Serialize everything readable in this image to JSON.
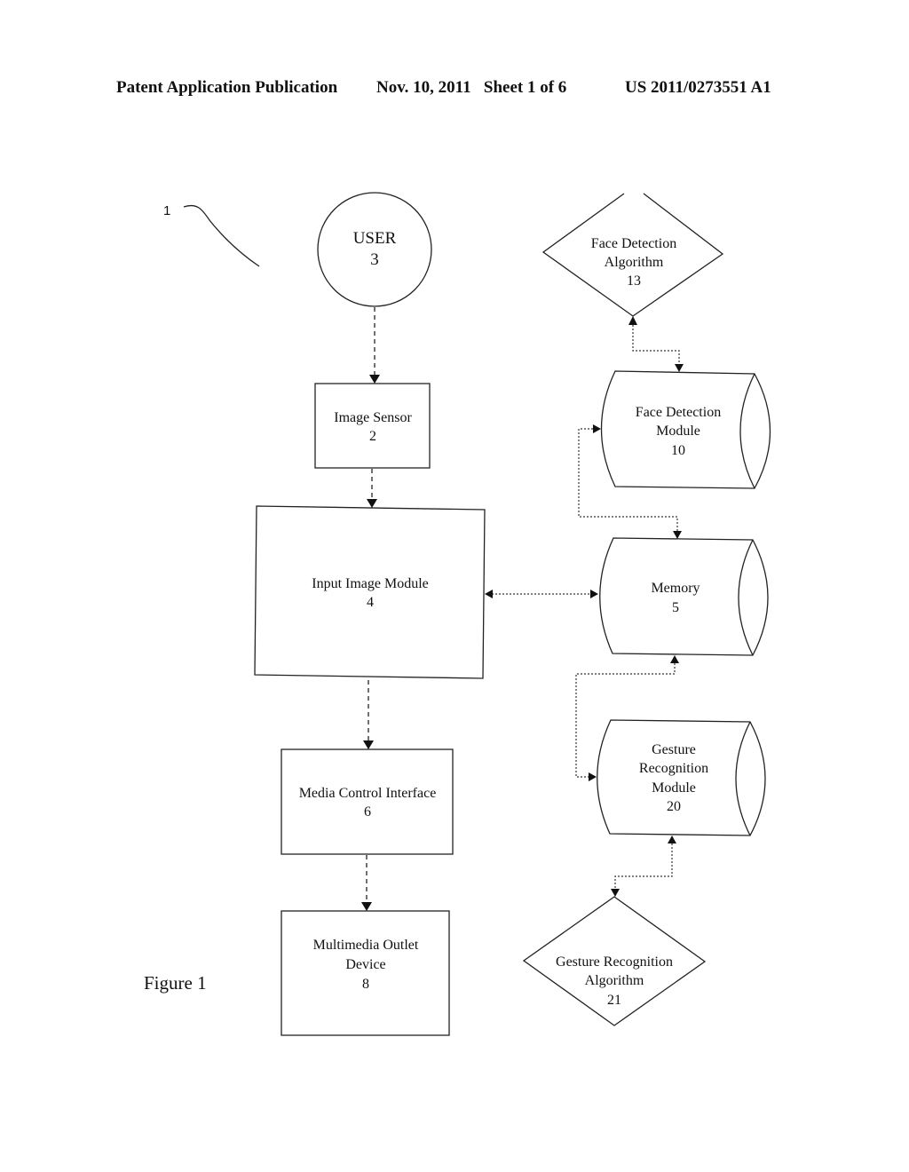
{
  "header": {
    "publication": "Patent Application Publication",
    "date_sheet": "Nov. 10, 2011   Sheet 1 of 6",
    "patent_number": "US 2011/0273551 A1"
  },
  "figure": {
    "label": "Figure 1",
    "reference": "1"
  },
  "nodes": {
    "user": {
      "title": "USER",
      "number": "3"
    },
    "image_sensor": {
      "title": "Image Sensor",
      "number": "2"
    },
    "input_image_module": {
      "title": "Input Image Module",
      "number": "4"
    },
    "media_control_interface": {
      "title": "Media Control Interface",
      "number": "6"
    },
    "multimedia_outlet_device": {
      "title_line1": "Multimedia Outlet",
      "title_line2": "Device",
      "number": "8"
    },
    "face_detection_algorithm": {
      "title_line1": "Face Detection",
      "title_line2": "Algorithm",
      "number": "13"
    },
    "face_detection_module": {
      "title_line1": "Face Detection",
      "title_line2": "Module",
      "number": "10"
    },
    "memory": {
      "title": "Memory",
      "number": "5"
    },
    "gesture_recognition_module": {
      "title_line1": "Gesture",
      "title_line2": "Recognition",
      "title_line3": "Module",
      "number": "20"
    },
    "gesture_recognition_algorithm": {
      "title_line1": "Gesture Recognition",
      "title_line2": "Algorithm",
      "number": "21"
    }
  },
  "edges": [
    {
      "from": "user",
      "to": "image_sensor",
      "style": "dashed",
      "direction": "forward"
    },
    {
      "from": "image_sensor",
      "to": "input_image_module",
      "style": "dashed",
      "direction": "forward"
    },
    {
      "from": "input_image_module",
      "to": "media_control_interface",
      "style": "dashed",
      "direction": "forward"
    },
    {
      "from": "media_control_interface",
      "to": "multimedia_outlet_device",
      "style": "dashed",
      "direction": "forward"
    },
    {
      "from": "input_image_module",
      "to": "memory",
      "style": "dotted",
      "direction": "both"
    },
    {
      "from": "face_detection_algorithm",
      "to": "face_detection_module",
      "style": "dotted",
      "direction": "both"
    },
    {
      "from": "face_detection_module",
      "to": "memory",
      "style": "dotted",
      "direction": "both"
    },
    {
      "from": "memory",
      "to": "gesture_recognition_module",
      "style": "dotted",
      "direction": "both"
    },
    {
      "from": "gesture_recognition_module",
      "to": "gesture_recognition_algorithm",
      "style": "dotted",
      "direction": "both"
    }
  ]
}
